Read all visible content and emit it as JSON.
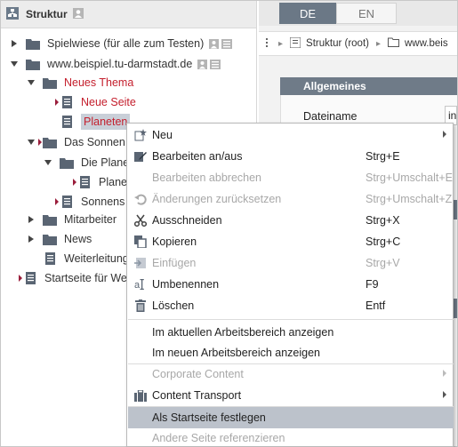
{
  "left_panel": {
    "title": "Struktur",
    "tree": [
      {
        "label": "Spielwiese (für alle zum Testen)",
        "red": false,
        "selected": false
      },
      {
        "label": "www.beispiel.tu-darmstadt.de",
        "red": false,
        "selected": false
      },
      {
        "label": "Neues Thema",
        "red": true,
        "selected": false
      },
      {
        "label": "Neue Seite",
        "red": true,
        "selected": false
      },
      {
        "label": "Planeten",
        "red": true,
        "selected": true
      },
      {
        "label": "Das Sonnen",
        "red": false,
        "selected": false
      },
      {
        "label": "Die Plane",
        "red": false,
        "selected": false
      },
      {
        "label": "Plane",
        "red": false,
        "selected": false
      },
      {
        "label": "Sonnens",
        "red": false,
        "selected": false
      },
      {
        "label": "Mitarbeiter",
        "red": false,
        "selected": false
      },
      {
        "label": "News",
        "red": false,
        "selected": false
      },
      {
        "label": "Weiterleitung",
        "red": false,
        "selected": false
      },
      {
        "label": "Startseite für We",
        "red": false,
        "selected": false
      }
    ]
  },
  "right_panel": {
    "tabs": [
      "DE",
      "EN"
    ],
    "breadcrumb": [
      "Struktur (root)",
      "www.beis"
    ],
    "section_title": "Allgemeines",
    "field_label": "Dateiname",
    "field_value": "in"
  },
  "context_menu": {
    "items": [
      {
        "label": "Neu",
        "shortcut": "",
        "icon": "new-icon",
        "disabled": false,
        "submenu": true,
        "highlight": false
      },
      {
        "label": "Bearbeiten an/aus",
        "shortcut": "Strg+E",
        "icon": "edit-icon",
        "disabled": false,
        "submenu": false,
        "highlight": false
      },
      {
        "label": "Bearbeiten abbrechen",
        "shortcut": "Strg+Umschalt+E",
        "icon": "",
        "disabled": true,
        "submenu": false,
        "highlight": false
      },
      {
        "label": "Änderungen zurücksetzen",
        "shortcut": "Strg+Umschalt+Z",
        "icon": "undo-icon",
        "disabled": true,
        "submenu": false,
        "highlight": false
      },
      {
        "label": "Ausschneiden",
        "shortcut": "Strg+X",
        "icon": "scissors-icon",
        "disabled": false,
        "submenu": false,
        "highlight": false
      },
      {
        "label": "Kopieren",
        "shortcut": "Strg+C",
        "icon": "copy-icon",
        "disabled": false,
        "submenu": false,
        "highlight": false
      },
      {
        "label": "Einfügen",
        "shortcut": "Strg+V",
        "icon": "paste-icon",
        "disabled": true,
        "submenu": false,
        "highlight": false
      },
      {
        "label": "Umbenennen",
        "shortcut": "F9",
        "icon": "rename-icon",
        "disabled": false,
        "submenu": false,
        "highlight": false
      },
      {
        "label": "Löschen",
        "shortcut": "Entf",
        "icon": "trash-icon",
        "disabled": false,
        "submenu": false,
        "highlight": false
      },
      {
        "label": "Im aktuellen Arbeitsbereich anzeigen",
        "shortcut": "",
        "icon": "",
        "disabled": false,
        "submenu": false,
        "highlight": false
      },
      {
        "label": "Im neuen Arbeitsbereich anzeigen",
        "shortcut": "",
        "icon": "",
        "disabled": false,
        "submenu": false,
        "highlight": false
      },
      {
        "label": "Corporate Content",
        "shortcut": "",
        "icon": "",
        "disabled": true,
        "submenu": true,
        "highlight": false
      },
      {
        "label": "Content Transport",
        "shortcut": "",
        "icon": "suitcase-icon",
        "disabled": false,
        "submenu": true,
        "highlight": false
      },
      {
        "label": "Als Startseite festlegen",
        "shortcut": "",
        "icon": "",
        "disabled": false,
        "submenu": false,
        "highlight": true
      },
      {
        "label": "Andere Seite referenzieren",
        "shortcut": "",
        "icon": "",
        "disabled": true,
        "submenu": false,
        "highlight": false
      }
    ]
  },
  "colors": {
    "accent": "#6f7b88",
    "red_text": "#c41e2c",
    "highlight": "#bcc2cb"
  }
}
